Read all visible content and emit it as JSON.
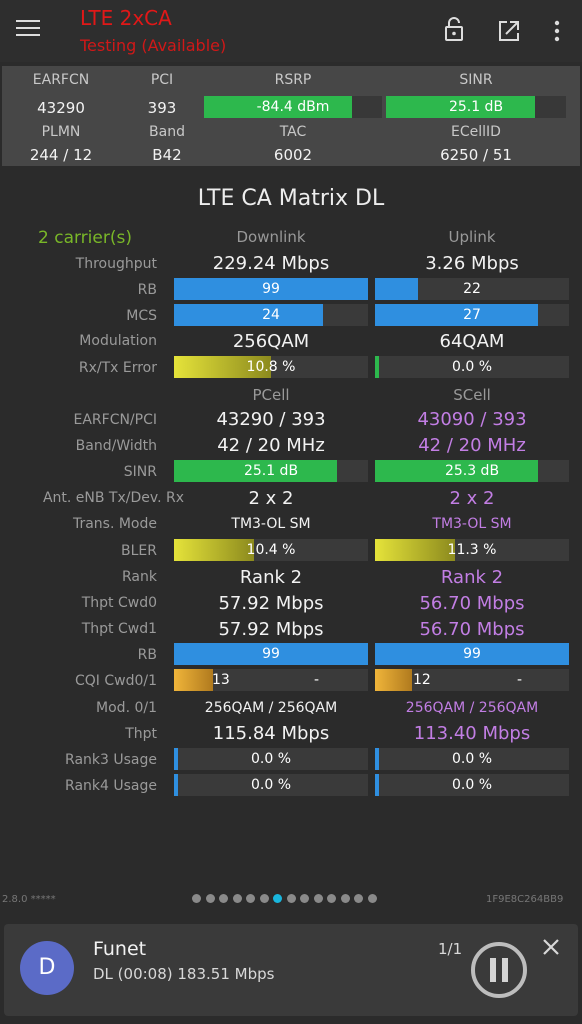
{
  "header": {
    "title": "LTE 2xCA",
    "subtitle": "Testing (Available)"
  },
  "summary": {
    "earfcn_label": "EARFCN",
    "earfcn": "43290",
    "pci_label": "PCI",
    "pci": "393",
    "rsrp_label": "RSRP",
    "rsrp": "-84.4 dBm",
    "rsrp_level": 0.83,
    "sinr_label": "SINR",
    "sinr": "25.1 dB",
    "sinr_level": 0.83,
    "plmn_label": "PLMN",
    "plmn": "244 / 12",
    "band_label": "Band",
    "band": "B42",
    "tac_label": "TAC",
    "tac": "6002",
    "ecellid_label": "ECellID",
    "ecellid": "6250 / 51"
  },
  "matrix": {
    "title": "LTE CA Matrix DL",
    "carriers": "2 carrier(s)",
    "downlink_label": "Downlink",
    "uplink_label": "Uplink",
    "throughput_label": "Throughput",
    "throughput_dl": "229.24 Mbps",
    "throughput_ul": "3.26 Mbps",
    "rb_label": "RB",
    "rb_dl": "99",
    "rb_dl_level": 1.0,
    "rb_ul": "22",
    "rb_ul_level": 0.22,
    "mcs_label": "MCS",
    "mcs_dl": "24",
    "mcs_dl_level": 0.77,
    "mcs_ul": "27",
    "mcs_ul_level": 0.84,
    "modulation_label": "Modulation",
    "modulation_dl": "256QAM",
    "modulation_ul": "64QAM",
    "rxtx_error_label": "Rx/Tx Error",
    "rxtx_error_dl": "10.8 %",
    "rxtx_error_dl_level": 0.5,
    "rxtx_error_ul": "0.0 %",
    "rxtx_error_ul_level": 0.02,
    "pcell_label": "PCell",
    "scell_label": "SCell",
    "earfcn_pci_label": "EARFCN/PCI",
    "earfcn_pci_p": "43290 / 393",
    "earfcn_pci_s": "43090 / 393",
    "band_width_label": "Band/Width",
    "band_width_p": "42 / 20 MHz",
    "band_width_s": "42 / 20 MHz",
    "sinr_label": "SINR",
    "sinr_p": "25.1 dB",
    "sinr_p_level": 0.84,
    "sinr_s": "25.3 dB",
    "sinr_s_level": 0.84,
    "ant_label": "Ant. eNB Tx/Dev. Rx",
    "ant_p": "2 x 2",
    "ant_s": "2 x 2",
    "trans_mode_label": "Trans. Mode",
    "trans_mode_p": "TM3-OL SM",
    "trans_mode_s": "TM3-OL SM",
    "bler_label": "BLER",
    "bler_p": "10.4 %",
    "bler_p_level": 0.41,
    "bler_s": "11.3 %",
    "bler_s_level": 0.41,
    "rank_label": "Rank",
    "rank_p": "Rank 2",
    "rank_s": "Rank 2",
    "thpt_cwd0_label": "Thpt Cwd0",
    "thpt_cwd0_p": "57.92 Mbps",
    "thpt_cwd0_s": "56.70 Mbps",
    "thpt_cwd1_label": "Thpt Cwd1",
    "thpt_cwd1_p": "57.92 Mbps",
    "thpt_cwd1_s": "56.70 Mbps",
    "rb2_label": "RB",
    "rb2_p": "99",
    "rb2_p_level": 1.0,
    "rb2_s": "99",
    "rb2_s_level": 1.0,
    "cqi_label": "CQI Cwd0/1",
    "cqi_p0": "13",
    "cqi_p1": "-",
    "cqi_p0_level": 0.2,
    "cqi_s0": "12",
    "cqi_s1": "-",
    "cqi_s0_level": 0.19,
    "mod01_label": "Mod. 0/1",
    "mod01_p": "256QAM / 256QAM",
    "mod01_s": "256QAM / 256QAM",
    "thpt_label": "Thpt",
    "thpt_p": "115.84 Mbps",
    "thpt_s": "113.40 Mbps",
    "rank3_label": "Rank3 Usage",
    "rank3_p": "0.0 %",
    "rank3_s": "0.0 %",
    "rank4_label": "Rank4 Usage",
    "rank4_p": "0.0 %",
    "rank4_s": "0.0 %"
  },
  "footer": {
    "version": "2.8.0 *****",
    "device_id": "1F9E8C264BB9",
    "page_count": 14,
    "active_page": 7
  },
  "notification": {
    "avatar_letter": "D",
    "app": "Funet",
    "detail": "DL (00:08) 183.51 Mbps",
    "count": "1/1"
  },
  "colors": {
    "title_red": "#e01818",
    "bar_green": "#2db84d",
    "bar_blue": "#2f8fe0",
    "bar_yellow": "#d9d72a",
    "bar_orange": "#e0a030",
    "pcell_text": "#f2f2f2",
    "scell_purple": "#c27ee4",
    "carrier_green": "#79b728",
    "active_dot": "#19b6dd"
  }
}
